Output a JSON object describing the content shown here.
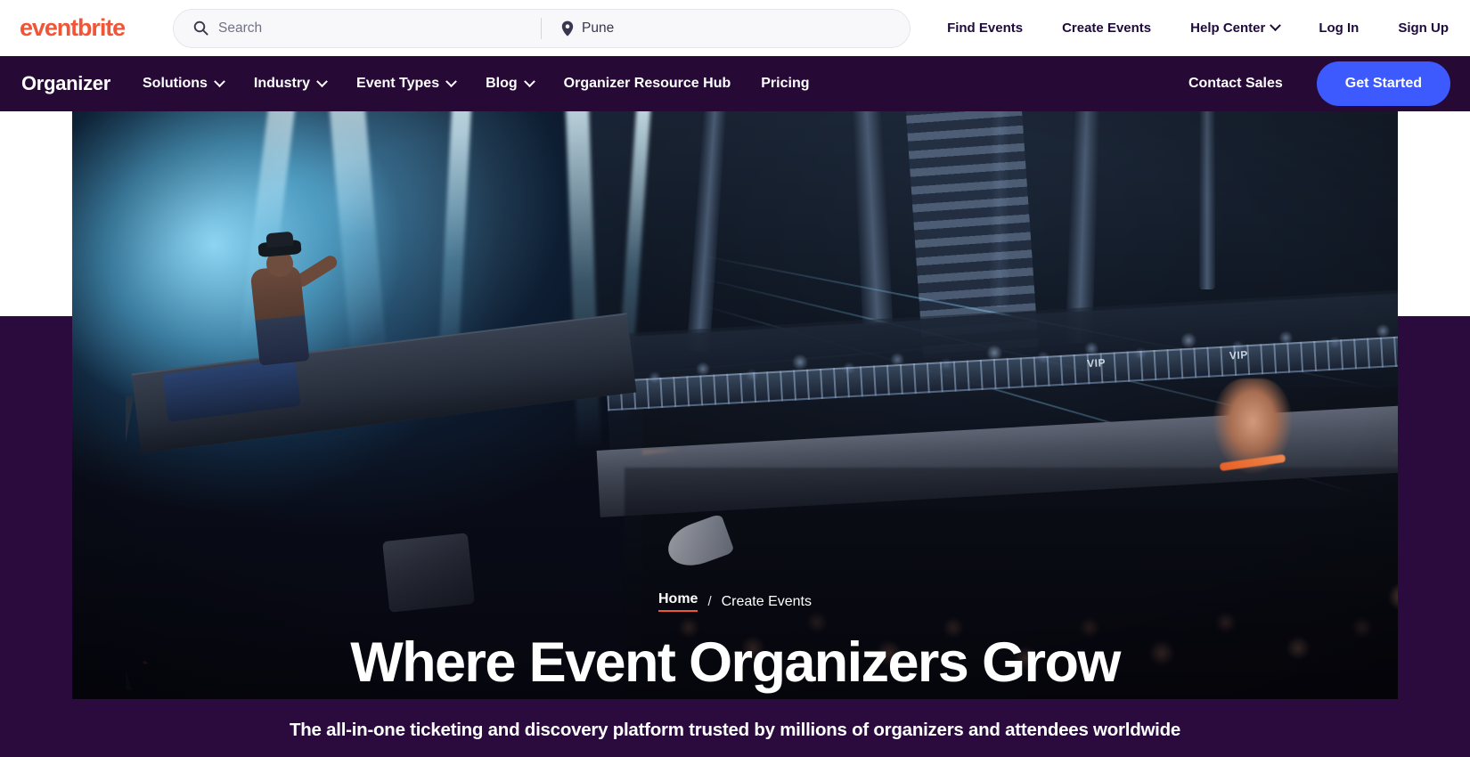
{
  "header": {
    "logo_text": "eventbrite",
    "search": {
      "search_icon": "search-icon",
      "search_placeholder": "Search",
      "location_icon": "map-pin-icon",
      "location_value": "Pune"
    },
    "nav": [
      {
        "label": "Find Events",
        "has_chevron": false
      },
      {
        "label": "Create Events",
        "has_chevron": false
      },
      {
        "label": "Help Center",
        "has_chevron": true
      },
      {
        "label": "Log In",
        "has_chevron": false
      },
      {
        "label": "Sign Up",
        "has_chevron": false
      }
    ]
  },
  "organizer_bar": {
    "title": "Organizer",
    "links": [
      {
        "label": "Solutions",
        "has_chevron": true
      },
      {
        "label": "Industry",
        "has_chevron": true
      },
      {
        "label": "Event Types",
        "has_chevron": true
      },
      {
        "label": "Blog",
        "has_chevron": true
      },
      {
        "label": "Organizer Resource Hub",
        "has_chevron": false
      },
      {
        "label": "Pricing",
        "has_chevron": false
      }
    ],
    "contact_sales_label": "Contact Sales",
    "get_started_label": "Get Started",
    "get_started_color": "#3D5AFE",
    "background_color": "#260A35"
  },
  "hero": {
    "breadcrumb": {
      "home_label": "Home",
      "separator": "/",
      "current_label": "Create Events",
      "active_underline_color": "#F05537"
    },
    "title": "Where Event Organizers Grow",
    "subtitle": "The all-in-one ticketing and discovery platform trusted by millions of organizers and attendees worldwide",
    "background_color": "#2B0A3D",
    "image_alt": "concert-stage-dj-crowd-photo"
  },
  "brand": {
    "logo_color": "#F05537",
    "text_dark": "#1E0A3C"
  }
}
